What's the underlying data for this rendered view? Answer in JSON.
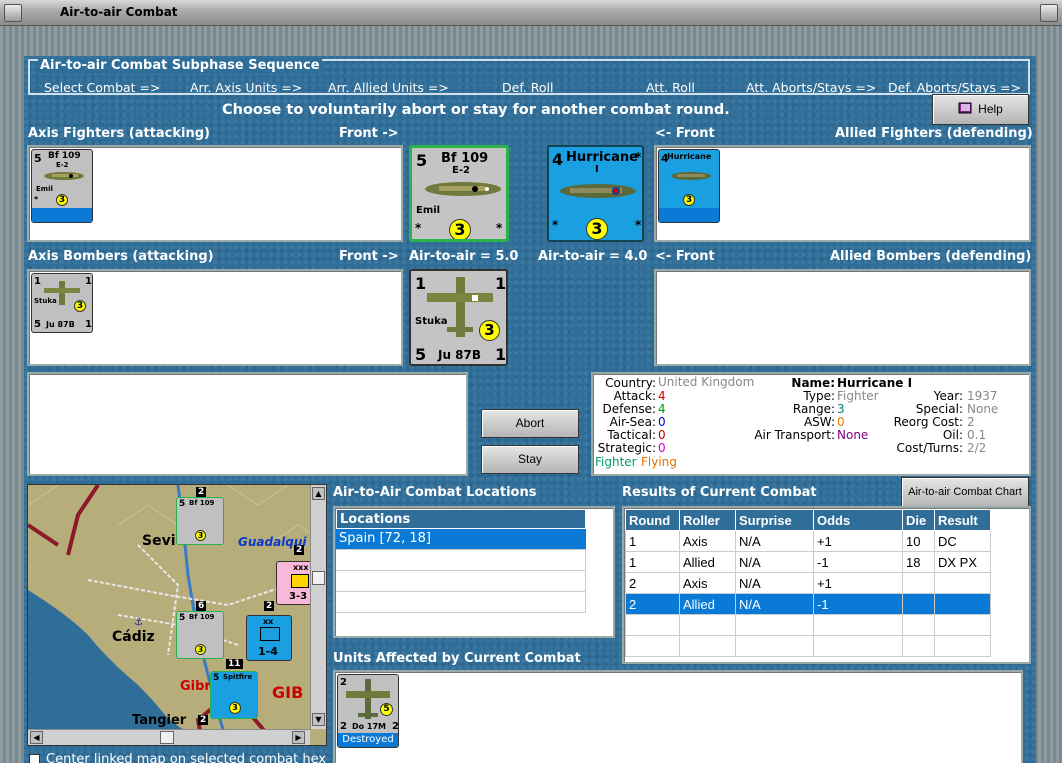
{
  "window": {
    "title": "Air-to-air Combat"
  },
  "sequence": {
    "title": "Air-to-air Combat Subphase Sequence",
    "steps": [
      "Select Combat =>",
      "Arr. Axis Units =>",
      "Arr. Allied Units =>",
      "Def. Roll",
      "Att. Roll",
      "Att. Aborts/Stays =>",
      "Def. Aborts/Stays =>"
    ]
  },
  "instruction": "Choose to voluntarily abort or stay for another combat round.",
  "help_label": "Help",
  "sections": {
    "axis_fighters": "Axis Fighters (attacking)",
    "front_right": "Front ->",
    "front_left": "<- Front",
    "allied_fighters": "Allied Fighters (defending)",
    "axis_bombers": "Axis Bombers (attacking)",
    "allied_bombers": "Allied Bombers (defending)"
  },
  "strength": {
    "axis": "Air-to-air = 5.0",
    "allied": "Air-to-air = 4.0"
  },
  "units": {
    "bf109": {
      "name": "Bf 109",
      "variant": "E-2",
      "pilot": "Emil",
      "air": "5",
      "range": "3",
      "corner": "*"
    },
    "hurricane": {
      "name": "Hurricane",
      "variant": "I",
      "air": "4",
      "range": "3",
      "corner": "*"
    },
    "stuka": {
      "name": "Stuka",
      "model": "Ju 87B",
      "tac": "1",
      "range": "3",
      "air": "5",
      "def": "1"
    },
    "spitfire": {
      "name": "Spitfire",
      "range": "3",
      "air": "5"
    },
    "do17": {
      "model": "Do 17M",
      "air": "2",
      "def": "2",
      "range": "5",
      "status": "Destroyed"
    }
  },
  "buttons": {
    "abort": "Abort",
    "stay": "Stay",
    "chart": "Air-to-air Combat Chart"
  },
  "info": {
    "country_label": "Country:",
    "country": "United Kingdom",
    "attack_label": "Attack:",
    "attack": "4",
    "defense_label": "Defense:",
    "defense": "4",
    "airsea_label": "Air-Sea:",
    "airsea": "0",
    "tactical_label": "Tactical:",
    "tactical": "0",
    "strategic_label": "Strategic:",
    "strategic": "0",
    "class_fighter": "Fighter",
    "class_flying": "Flying",
    "name_label": "Name:",
    "name": "Hurricane I",
    "type_label": "Type:",
    "type": "Fighter",
    "range_label": "Range:",
    "range": "3",
    "asw_label": "ASW:",
    "asw": "0",
    "airtransport_label": "Air Transport:",
    "airtransport": "None",
    "year_label": "Year:",
    "year": "1937",
    "special_label": "Special:",
    "special": "None",
    "reorg_label": "Reorg Cost:",
    "reorg": "2",
    "oil_label": "Oil:",
    "oil": "0.1",
    "cost_label": "Cost/Turns:",
    "cost": "2/2",
    "colors": {
      "attack": "#d40000",
      "defense": "#00a000",
      "airsea": "#0000cc",
      "tactical": "#c00000",
      "strategic": "#cc00cc",
      "fighter": "#00a060",
      "flying": "#e07000",
      "asw": "#e08000",
      "range": "#008080",
      "airtransport": "#800080",
      "gray": "#888888"
    }
  },
  "map": {
    "labels": {
      "sevilla": "Sevi",
      "guadalquivir": "Guadalqui",
      "cadiz": "Cádiz",
      "gib1": "Gibr",
      "gib2": "GIB",
      "tangier": "Tangier"
    },
    "stacks": {
      "a": "2",
      "b": "6",
      "c": "2",
      "d": "11",
      "e": "2",
      "f": "2"
    },
    "inf1": "3-3",
    "inf2": "1-4",
    "inf_xxx": "xxx",
    "inf_xx": "xx"
  },
  "locations": {
    "title": "Air-to-Air Combat Locations",
    "header": "Locations",
    "rows": [
      "Spain [72, 18]"
    ]
  },
  "results": {
    "title": "Results of Current Combat",
    "headers": [
      "Round",
      "Roller",
      "Surprise",
      "Odds",
      "Die",
      "Result"
    ],
    "rows": [
      [
        "1",
        "Axis",
        "N/A",
        "+1",
        "10",
        "DC"
      ],
      [
        "1",
        "Allied",
        "N/A",
        "-1",
        "18",
        "DX PX"
      ],
      [
        "2",
        "Axis",
        "N/A",
        "+1",
        "",
        ""
      ],
      [
        "2",
        "Allied",
        "N/A",
        "-1",
        "",
        ""
      ]
    ],
    "selected_row": 3
  },
  "affected": {
    "title": "Units Affected by Current Combat"
  },
  "checkbox": {
    "label": "Center linked map on selected combat hex",
    "checked": false
  }
}
